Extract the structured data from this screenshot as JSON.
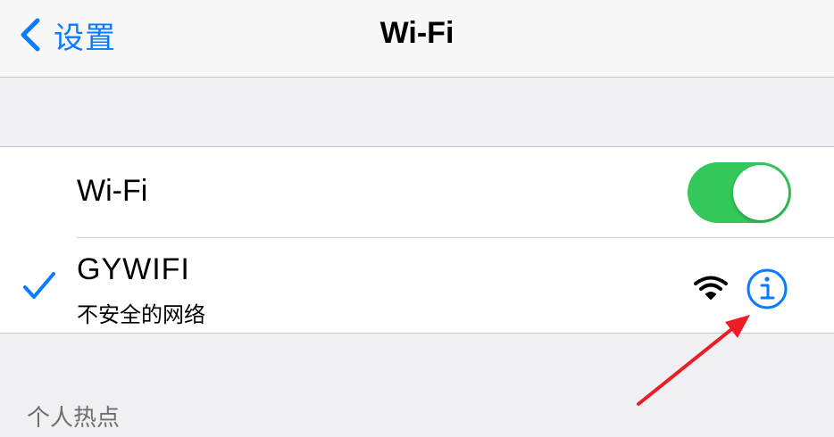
{
  "navbar": {
    "back_label": "设置",
    "title": "Wi-Fi"
  },
  "wifi_row": {
    "label": "Wi-Fi",
    "toggle_on": true
  },
  "network": {
    "name": "GYWIFI",
    "subtitle": "不安全的网络",
    "connected": true
  },
  "section_header": "个人热点",
  "colors": {
    "accent": "#0a7aff",
    "toggle_on": "#34c759",
    "annotation_arrow": "#ee1c24"
  }
}
